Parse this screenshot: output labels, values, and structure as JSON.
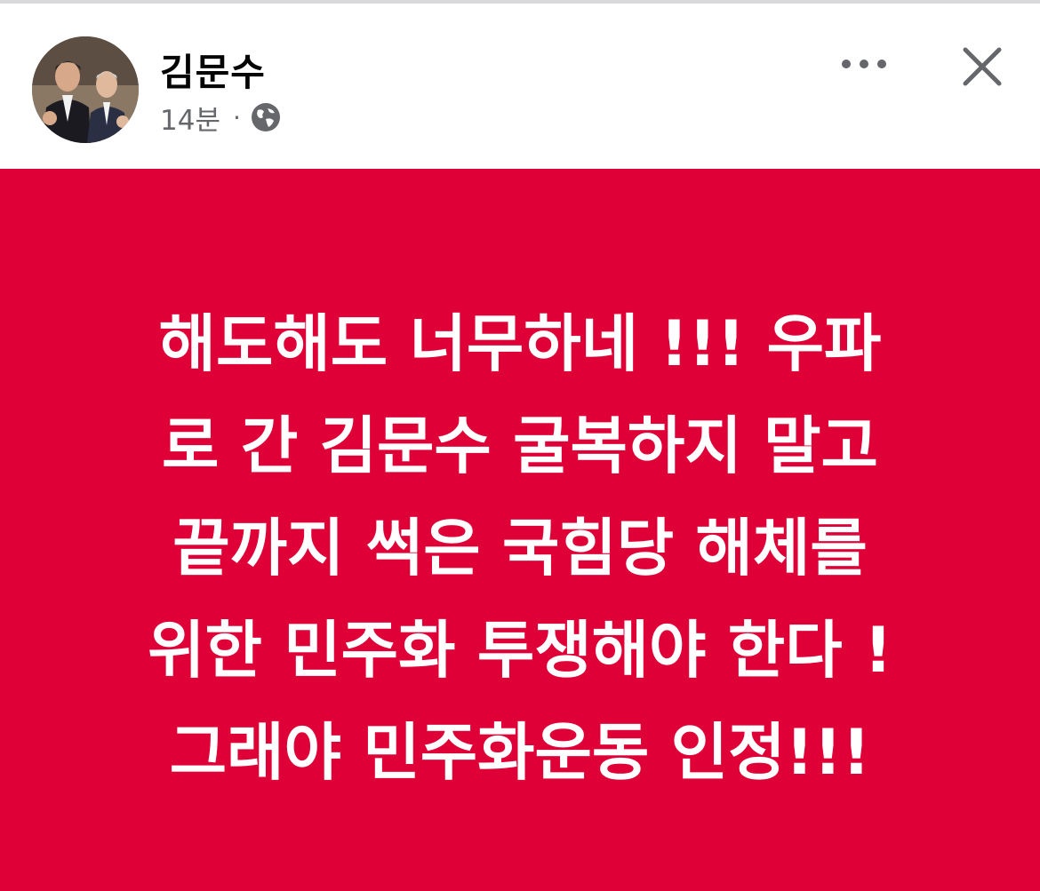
{
  "post": {
    "author": "김문수",
    "time": "14분",
    "separator": "·",
    "privacy_icon": "globe-icon",
    "more_icon": "more-horizontal-icon",
    "close_icon": "close-icon",
    "background_color": "#df0037",
    "text_lines": [
      "해도해도 너무하네 !!! 우파",
      "로 간 김문수 굴복하지 말고",
      "끝까지 썩은 국힘당 해체를",
      "위한 민주화 투쟁해야 한다 !",
      "그래야 민주화운동 인정!!!"
    ]
  }
}
